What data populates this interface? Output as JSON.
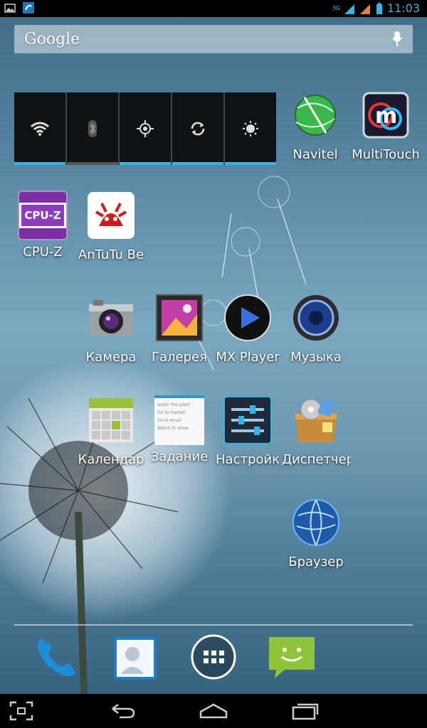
{
  "status": {
    "time": "11:03",
    "network": "3G",
    "icons": [
      "image-icon",
      "sync-icon",
      "signal-3g-icon",
      "signal-icon",
      "battery-icon"
    ]
  },
  "search": {
    "label": "Google",
    "icon": "mic-icon"
  },
  "power_widget": {
    "toggles": [
      {
        "name": "wifi",
        "icon": "wifi-icon",
        "state": "on"
      },
      {
        "name": "bluetooth",
        "icon": "bluetooth-icon",
        "state": "off"
      },
      {
        "name": "gps",
        "icon": "gps-icon",
        "state": "on"
      },
      {
        "name": "sync",
        "icon": "sync-icon",
        "state": "on"
      },
      {
        "name": "brightness",
        "icon": "brightness-icon",
        "state": "on"
      }
    ],
    "accent": "#33b5e5"
  },
  "apps": {
    "navitel": "Navitel",
    "multitouch": "MultiTouch",
    "cpuz": "CPU-Z",
    "antutu": "AnTuTu Be",
    "camera": "Камера",
    "gallery": "Галерея",
    "mxplayer": "MX Player",
    "music": "Музыка",
    "calendar": "Календар",
    "tasks": "Задание",
    "settings": "Настройк",
    "filemanager": "Диспетчер",
    "browser": "Браузер"
  },
  "icon_text": {
    "cpuz": "CPU-Z",
    "tasks_rows": [
      "water the plant",
      "Go to market",
      "Send email",
      "Watch tv show"
    ]
  },
  "dock": [
    "phone-icon",
    "contacts-icon",
    "app-drawer-icon",
    "messaging-icon"
  ],
  "nav": [
    "screenshot-icon",
    "back-icon",
    "home-icon",
    "recents-icon"
  ]
}
